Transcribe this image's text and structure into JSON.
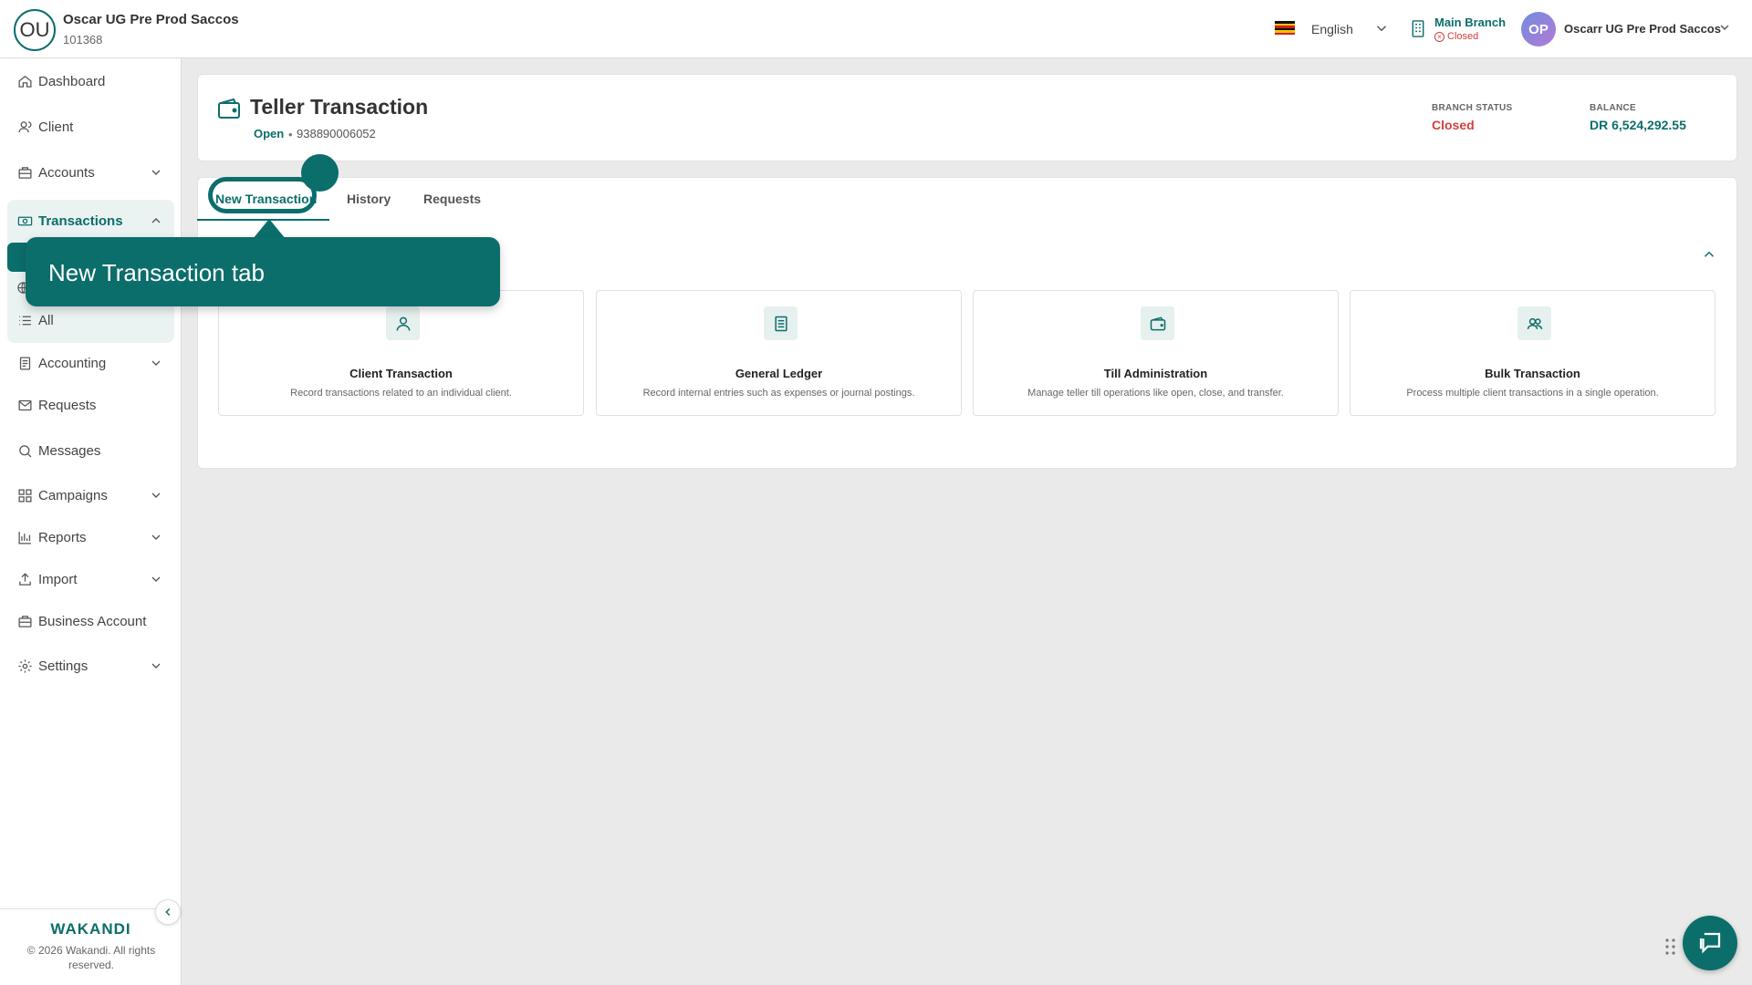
{
  "header": {
    "org_initials": "OU",
    "org_name": "Oscar UG Pre Prod Saccos",
    "org_id": "101368",
    "language": "English",
    "branch_name": "Main Branch",
    "branch_status": "Closed",
    "user_initials": "OP",
    "user_name": "Oscarr UG Pre Prod Saccos"
  },
  "sidebar": {
    "items": [
      {
        "label": "Dashboard",
        "icon": "home-icon"
      },
      {
        "label": "Client",
        "icon": "user-icon"
      },
      {
        "label": "Accounts",
        "icon": "briefcase-icon"
      },
      {
        "label": "Transactions",
        "icon": "money-icon"
      },
      {
        "label": "All",
        "icon": "list-icon"
      },
      {
        "label": "Accounting",
        "icon": "book-icon"
      },
      {
        "label": "Requests",
        "icon": "mail-icon"
      },
      {
        "label": "Messages",
        "icon": "chat-icon"
      },
      {
        "label": "Campaigns",
        "icon": "grid-icon"
      },
      {
        "label": "Reports",
        "icon": "bar-chart-icon"
      },
      {
        "label": "Import",
        "icon": "upload-icon"
      },
      {
        "label": "Business Account",
        "icon": "briefcase-icon"
      },
      {
        "label": "Settings",
        "icon": "gear-icon"
      }
    ],
    "brand": "WAKANDI",
    "copyright": "© 2026 Wakandi. All rights reserved."
  },
  "page": {
    "title": "Teller Transaction",
    "till_state": "Open",
    "till_separator": "•",
    "till_number": "938890006052",
    "branch_status_label": "BRANCH STATUS",
    "branch_status_value": "Closed",
    "balance_label": "BALANCE",
    "balance_value": "DR 6,524,292.55"
  },
  "tabs": [
    {
      "label": "New Transaction"
    },
    {
      "label": "History"
    },
    {
      "label": "Requests"
    }
  ],
  "tiles": [
    {
      "title": "Client Transaction",
      "desc": "Record transactions related to an individual client.",
      "icon": "user-icon"
    },
    {
      "title": "General Ledger",
      "desc": "Record internal entries such as expenses or journal postings.",
      "icon": "ledger-icon"
    },
    {
      "title": "Till Administration",
      "desc": "Manage teller till operations like open, close, and transfer.",
      "icon": "wallet-icon"
    },
    {
      "title": "Bulk Transaction",
      "desc": "Process multiple client transactions in a single operation.",
      "icon": "users-icon"
    }
  ],
  "tooltip": {
    "text": "New Transaction tab"
  },
  "colors": {
    "accent": "#0b6e6b",
    "danger": "#d04040"
  }
}
